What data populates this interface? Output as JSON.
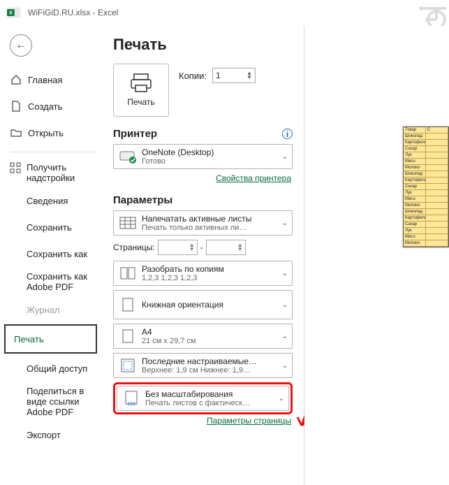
{
  "titlebar": {
    "filename": "WiFiGiD.RU.xlsx  -  Excel"
  },
  "sidebar": {
    "items": [
      {
        "label": "Главная"
      },
      {
        "label": "Создать"
      },
      {
        "label": "Открыть"
      },
      {
        "label": "Получить надстройки"
      },
      {
        "label": "Сведения"
      },
      {
        "label": "Сохранить"
      },
      {
        "label": "Сохранить как"
      },
      {
        "label": "Сохранить как Adobe PDF"
      },
      {
        "label": "Журнал"
      },
      {
        "label": "Печать"
      },
      {
        "label": "Общий доступ"
      },
      {
        "label": "Поделиться в виде ссылки Adobe PDF"
      },
      {
        "label": "Экспорт"
      }
    ]
  },
  "print": {
    "heading": "Печать",
    "button_label": "Печать",
    "copies_label": "Копии:",
    "copies_value": "1",
    "printer_heading": "Принтер",
    "printer": {
      "l1": "OneNote (Desktop)",
      "l2": "Готово"
    },
    "printer_props_link": "Свойства принтера",
    "params_heading": "Параметры",
    "active_sheets": {
      "l1": "Напечатать активные листы",
      "l2": "Печать только активных ли…"
    },
    "pages_label": "Страницы:",
    "pages_sep": "-",
    "collate": {
      "l1": "Разобрать по копиям",
      "l2": "1,2,3    1,2,3    1,2,3"
    },
    "orientation": {
      "l1": "Книжная ориентация"
    },
    "paper": {
      "l1": "A4",
      "l2": "21 см x 29,7 см"
    },
    "margins": {
      "l1": "Последние настраиваемые…",
      "l2": "Верхнее: 1,9 см Нижнее: 1,9…"
    },
    "scaling": {
      "l1": "Без масштабирования",
      "l2": "Печать листов с фактическ…"
    },
    "page_params_link": "Параметры страницы"
  },
  "chart_data": {
    "type": "table",
    "headers": [
      "Товар",
      "С"
    ],
    "rows": [
      "Шоколад",
      "Картофель",
      "Сахар",
      "Лук",
      "Мясо",
      "Молоко",
      "Шоколад",
      "Картофель",
      "Сахар",
      "Лук",
      "Мясо",
      "Молоко",
      "Шоколад",
      "Картофель",
      "Сахар",
      "Лук",
      "Мясо",
      "Молоко"
    ]
  }
}
